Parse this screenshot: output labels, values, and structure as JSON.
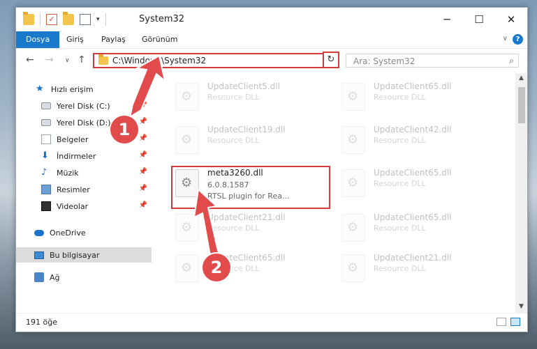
{
  "window": {
    "title": "System32"
  },
  "ribbon": {
    "tabs": [
      "Dosya",
      "Giriş",
      "Paylaş",
      "Görünüm"
    ],
    "help": "?"
  },
  "nav": {
    "back": "←",
    "forward": "→",
    "history": "∨",
    "up": "↑"
  },
  "address": {
    "path": "C:\\Windows\\System32",
    "refresh": "↻"
  },
  "search": {
    "placeholder": "Ara: System32"
  },
  "sidebar": {
    "items": [
      {
        "label": "Hızlı erişim",
        "icon": "star-icon"
      },
      {
        "label": "Yerel Disk (C:)",
        "icon": "drive-icon"
      },
      {
        "label": "Yerel Disk (D:)",
        "icon": "drive-icon"
      },
      {
        "label": "Belgeler",
        "icon": "documents-icon"
      },
      {
        "label": "İndirmeler",
        "icon": "downloads-icon"
      },
      {
        "label": "Müzik",
        "icon": "music-icon"
      },
      {
        "label": "Resimler",
        "icon": "pictures-icon"
      },
      {
        "label": "Videolar",
        "icon": "videos-icon"
      },
      {
        "label": "OneDrive",
        "icon": "onedrive-icon"
      },
      {
        "label": "Bu bilgisayar",
        "icon": "computer-icon"
      },
      {
        "label": "Ağ",
        "icon": "network-icon"
      }
    ]
  },
  "files": {
    "left": [
      {
        "name": "UpdateClient5.dll",
        "type": "Resource DLL"
      },
      {
        "name": "UpdateClient19.dll",
        "type": "Resource DLL"
      },
      {
        "name": "meta3260.dll",
        "version": "6.0.8.1587",
        "desc": "RTSL plugin for Rea..."
      },
      {
        "name": "UpdateClient21.dll",
        "type": "Resource DLL"
      },
      {
        "name": "UpdateClient65.dll",
        "type": "Resource DLL"
      }
    ],
    "right": [
      {
        "name": "UpdateClient65.dll",
        "type": "Resource DLL"
      },
      {
        "name": "UpdateClient42.dll",
        "type": "Resource DLL"
      },
      {
        "name": "UpdateClient65.dll",
        "type": "Resource DLL"
      },
      {
        "name": "UpdateClient65.dll",
        "type": "Resource DLL"
      },
      {
        "name": "UpdateClient21.dll",
        "type": "Resource DLL"
      }
    ]
  },
  "status": {
    "count": "191 öğe"
  },
  "annotations": {
    "step1": "1",
    "step2": "2"
  },
  "colors": {
    "accent": "#1979ca",
    "highlight": "#d23c3c"
  }
}
